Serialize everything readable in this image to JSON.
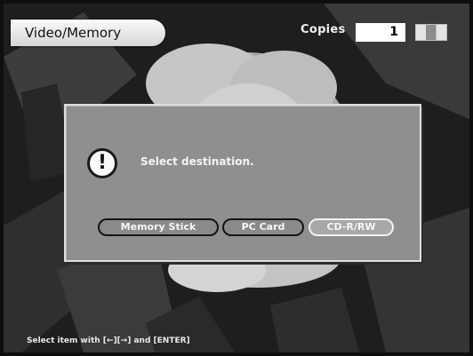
{
  "header": {
    "mode_title": "Video/Memory",
    "copies_label": "Copies",
    "copies_value": "1",
    "battery_icon": "battery-icon"
  },
  "dialog": {
    "icon": "exclamation-icon",
    "message": "Select destination.",
    "buttons": [
      {
        "label": "Memory Stick",
        "state": "normal"
      },
      {
        "label": "PC Card",
        "state": "normal"
      },
      {
        "label": "CD-R/RW",
        "state": "selected"
      }
    ]
  },
  "footer": {
    "hint": "Select item with [←][→] and [ENTER]"
  },
  "colors": {
    "dialog_bg": "#8f8f8f",
    "tab_bg": "#f0f0f0",
    "selected_border": "#f2f2f2"
  }
}
